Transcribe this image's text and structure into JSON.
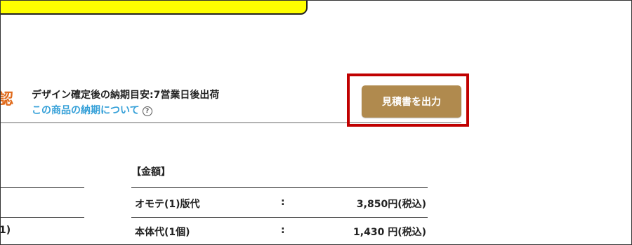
{
  "header": {
    "confirm_char": "認",
    "delivery_estimate": "デザイン確定後の納期目安:7営業日後出荷",
    "delivery_link": "この商品の納期について",
    "help_icon_glyph": "?"
  },
  "estimate_button": {
    "label": "見積書を出力"
  },
  "left_panel": {
    "row_fragment": "1)"
  },
  "amount": {
    "heading": "【金額】",
    "rows": [
      {
        "label": "オモテ(1)版代",
        "colon": ":",
        "price": "3,850円(税込)"
      },
      {
        "label": "本体代(1個)",
        "colon": ":",
        "price": "1,430 円(税込)"
      }
    ]
  },
  "colors": {
    "accent_orange": "#e06a1b",
    "link_blue": "#35a0d8",
    "button_gold": "#b08a4e",
    "highlight_red": "#c00000",
    "banner_yellow": "#ffff00"
  }
}
